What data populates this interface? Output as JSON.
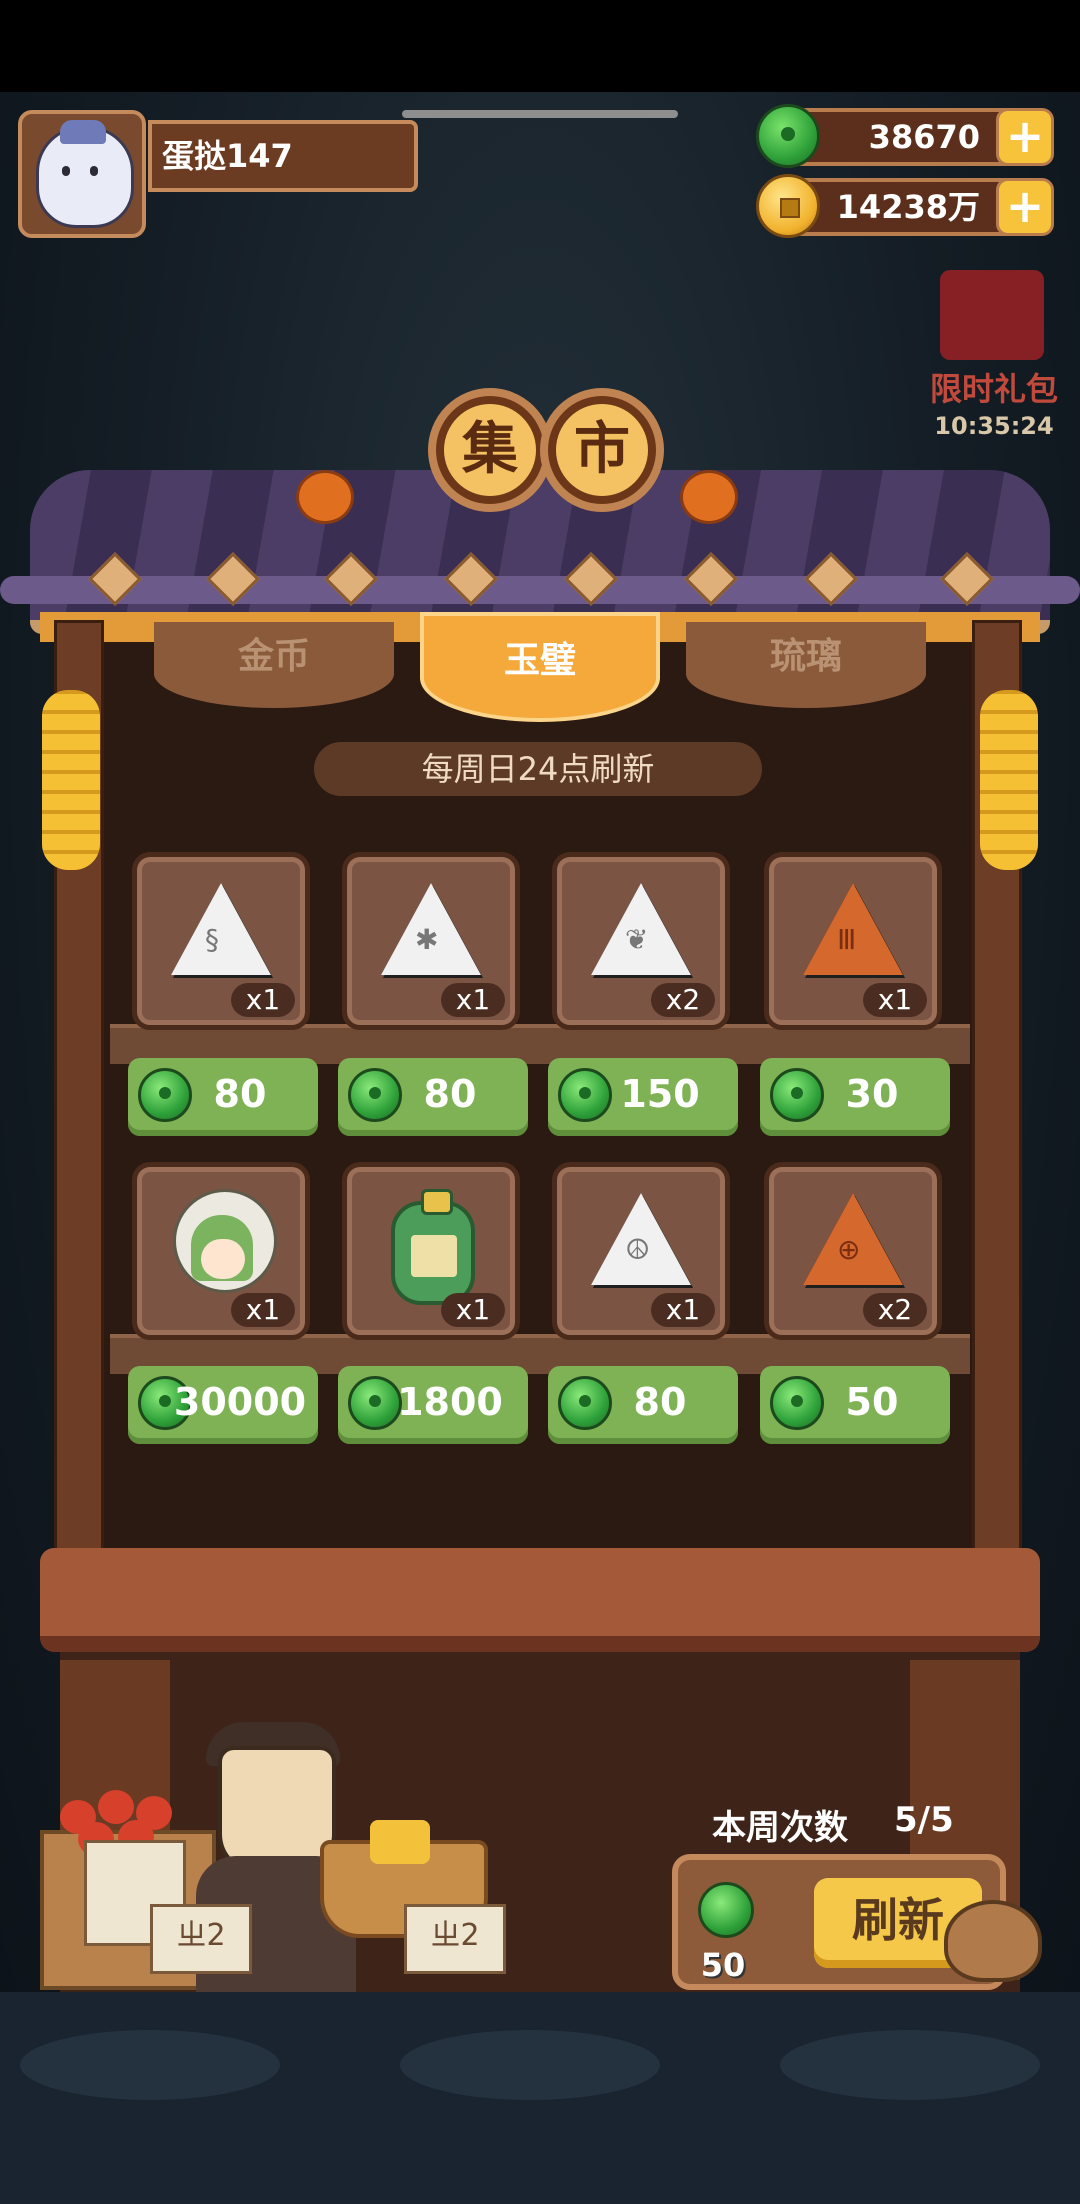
{
  "player": {
    "name": "蛋挞147"
  },
  "currencies": {
    "jade": {
      "value": "38670",
      "icon": "jade-icon"
    },
    "coins": {
      "value": "14238万",
      "icon": "coin-icon"
    }
  },
  "gift": {
    "label": "限时礼包",
    "timer": "10:35:24"
  },
  "title": {
    "char1": "集",
    "char2": "市"
  },
  "tabs": [
    {
      "label": "金币",
      "active": false
    },
    {
      "label": "玉璧",
      "active": true
    },
    {
      "label": "琉璃",
      "active": false
    }
  ],
  "refresh_notice": "每周日24点刷新",
  "items": [
    {
      "icon": "white-spiral-rune-icon",
      "qty": "x1",
      "price": "80"
    },
    {
      "icon": "white-crab-rune-icon",
      "qty": "x1",
      "price": "80"
    },
    {
      "icon": "white-deer-rune-icon",
      "qty": "x2",
      "price": "150"
    },
    {
      "icon": "orange-rune-icon",
      "qty": "x1",
      "price": "30"
    },
    {
      "icon": "green-hair-character-icon",
      "qty": "x1",
      "price": "30000"
    },
    {
      "icon": "green-scroll-book-icon",
      "qty": "x1",
      "price": "1800"
    },
    {
      "icon": "white-leaf-rune-icon",
      "qty": "x1",
      "price": "80"
    },
    {
      "icon": "orange-wheel-rune-icon",
      "qty": "x2",
      "price": "50"
    }
  ],
  "weekly": {
    "label": "本周次数",
    "value": "5/5"
  },
  "refresh": {
    "cost": "50",
    "label": "刷新"
  },
  "signs": {
    "left": "ㄓ2",
    "right": "ㄓ2"
  },
  "colors": {
    "jade": "#2fa23a",
    "price_bg": "#7fb255",
    "tab_active": "#f4a93a",
    "refresh_button": "#f6c84a"
  }
}
